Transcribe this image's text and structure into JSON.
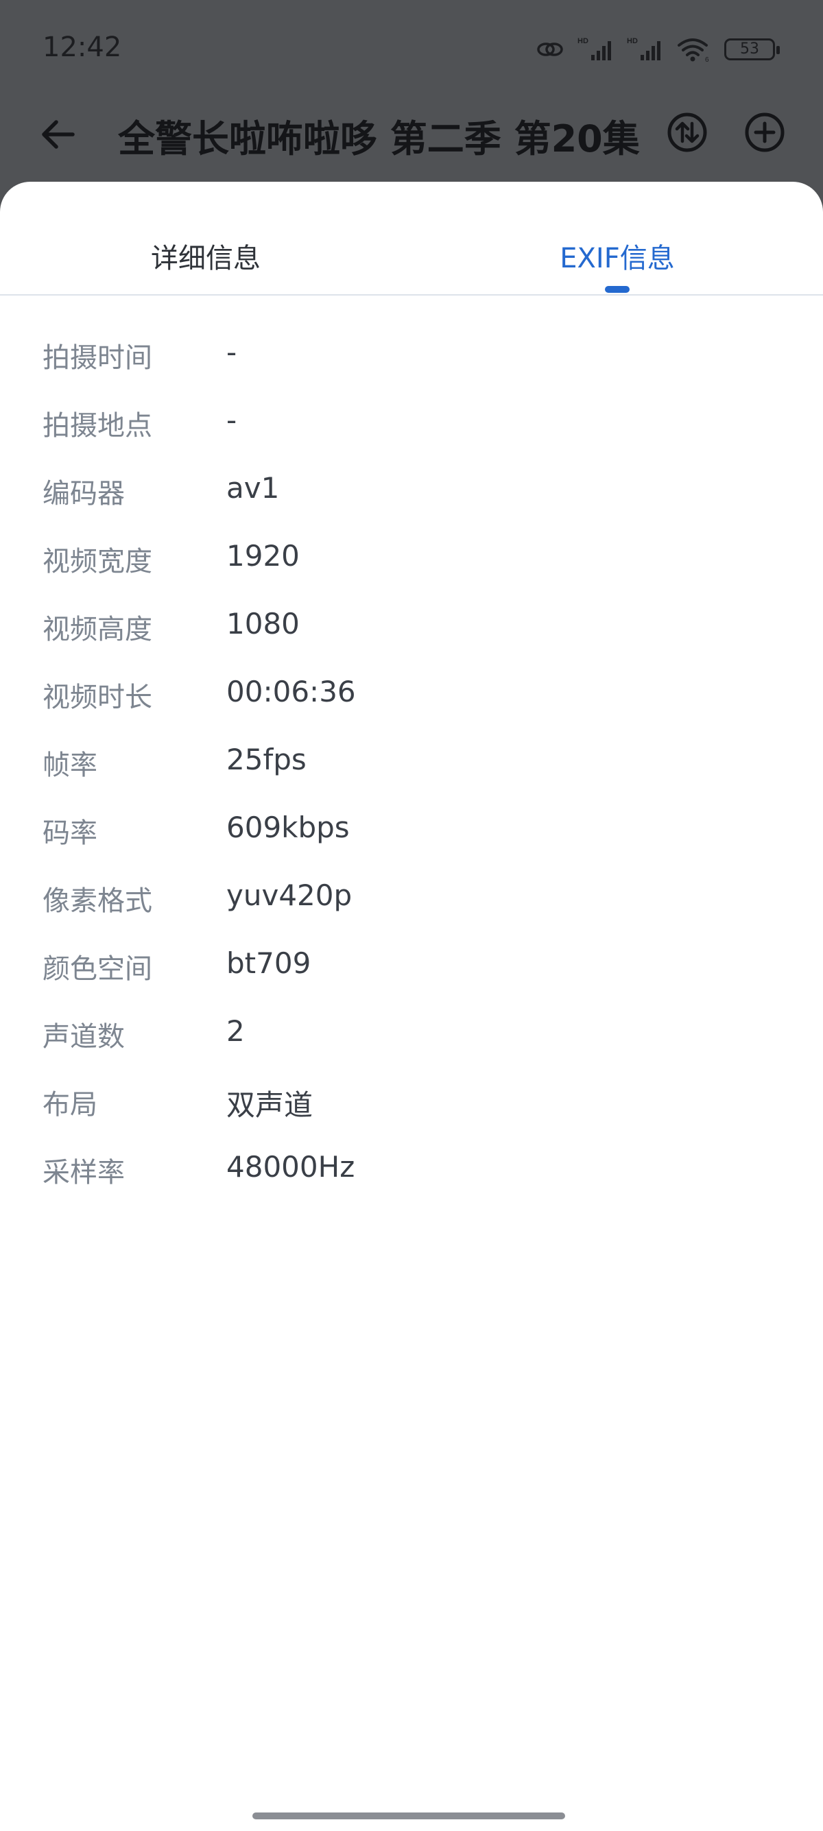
{
  "status_bar": {
    "time": "12:42",
    "battery": "53",
    "icons": [
      "link-icon",
      "hd-signal-icon",
      "hd-signal-icon",
      "wifi-icon",
      "battery-icon"
    ]
  },
  "app_bar": {
    "title": "全警长啦咘啦哆 第二季 第20集",
    "icons": [
      "back-arrow-icon",
      "sort-swap-icon",
      "add-circle-icon"
    ]
  },
  "tabs": [
    {
      "label": "详细信息",
      "selected": false
    },
    {
      "label": "EXIF信息",
      "selected": true
    }
  ],
  "exif": [
    {
      "label": "拍摄时间",
      "value": "-"
    },
    {
      "label": "拍摄地点",
      "value": "-"
    },
    {
      "label": "编码器",
      "value": "av1"
    },
    {
      "label": "视频宽度",
      "value": "1920"
    },
    {
      "label": "视频高度",
      "value": "1080"
    },
    {
      "label": "视频时长",
      "value": "00:06:36"
    },
    {
      "label": "帧率",
      "value": "25fps"
    },
    {
      "label": "码率",
      "value": "609kbps"
    },
    {
      "label": "像素格式",
      "value": "yuv420p"
    },
    {
      "label": "颜色空间",
      "value": "bt709"
    },
    {
      "label": "声道数",
      "value": "2"
    },
    {
      "label": "布局",
      "value": "双声道"
    },
    {
      "label": "采样率",
      "value": "48000Hz"
    }
  ],
  "colors": {
    "overlay": "#505255",
    "accent": "#2469cf",
    "label": "#7d8590",
    "value": "#3a3f47"
  }
}
